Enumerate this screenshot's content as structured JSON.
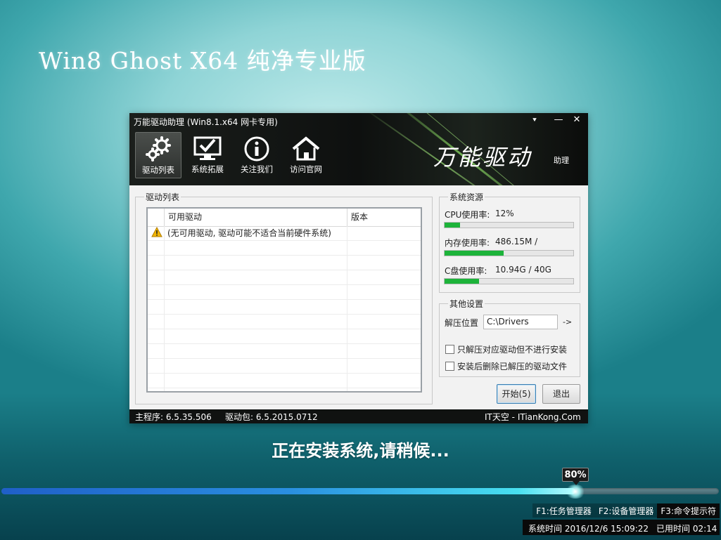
{
  "background": {
    "accent": "#3fa7ad"
  },
  "page_title": "Win8 Ghost X64 纯净专业版",
  "dialog": {
    "title": "万能驱动助理 (Win8.1.x64 网卡专用)",
    "controls": {
      "menu": "⯆",
      "minimize": "—",
      "close": "✕"
    },
    "toolbar": [
      {
        "label": "驱动列表",
        "icon": "gears-icon",
        "active": true
      },
      {
        "label": "系统拓展",
        "icon": "monitor-check-icon",
        "active": false
      },
      {
        "label": "关注我们",
        "icon": "info-icon",
        "active": false
      },
      {
        "label": "访问官网",
        "icon": "home-icon",
        "active": false
      }
    ],
    "brand": {
      "logo": "万能驱动",
      "sub": "助理"
    },
    "driver_list": {
      "legend": "驱动列表",
      "columns": [
        "可用驱动",
        "版本"
      ],
      "rows": [
        {
          "icon": "warning-icon",
          "name": "(无可用驱动, 驱动可能不适合当前硬件系统)",
          "version": ""
        }
      ]
    },
    "resources": {
      "legend": "系统资源",
      "items": [
        {
          "label": "CPU使用率:",
          "value": "12%",
          "fill": 0.12
        },
        {
          "label": "内存使用率:",
          "value": "486.15M /",
          "fill": 0.46
        },
        {
          "label": "C盘使用率:",
          "value": "10.94G / 40G",
          "fill": 0.27
        }
      ],
      "bar_color": "#1db33a"
    },
    "other_settings": {
      "legend": "其他设置",
      "extract_label": "解压位置",
      "extract_path": "C:\\Drivers",
      "arrow": "->",
      "checkboxes": [
        {
          "label": "只解压对应驱动但不进行安装",
          "checked": false
        },
        {
          "label": "安装后删除已解压的驱动文件",
          "checked": false
        }
      ]
    },
    "buttons": {
      "start": "开始(5)",
      "exit": "退出"
    },
    "status": {
      "main_program": "主程序: 6.5.35.506",
      "driver_pack": "驱动包: 6.5.2015.0712",
      "site": "IT天空 - ITianKong.Com"
    }
  },
  "installing_text": "正在安装系统,请稍候...",
  "progress": {
    "percent_label": "80%",
    "value": 0.8
  },
  "hotkeys": [
    {
      "label": "F1:任务管理器"
    },
    {
      "label": "F2:设备管理器"
    },
    {
      "label": "F3:命令提示符"
    }
  ],
  "time": {
    "system_time": "系统时间 2016/12/6 15:09:22",
    "elapsed": "已用时间 02:14"
  }
}
